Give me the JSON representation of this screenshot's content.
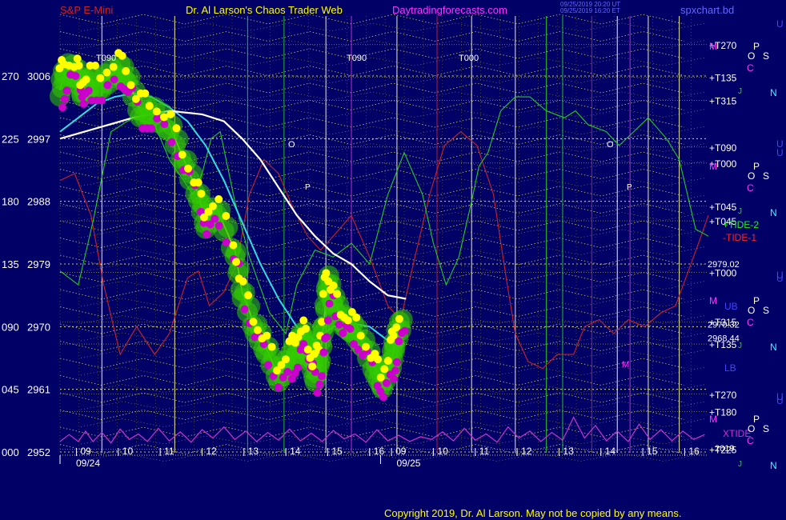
{
  "header": {
    "symbol": "S&P E-Mini",
    "site": "Dr. Al Larson's Chaos Trader Web",
    "url": "Daytradingforecasts.com",
    "timestamp_line1": "09/25/2019 20:20 UT",
    "timestamp_line2": "09/25/2019 16:20 ET",
    "filename": "spxchart.bd"
  },
  "footer": {
    "copyright": "Copyright 2019, Dr. Al Larson. May not be copied by any means."
  },
  "colors": {
    "background": "#000066",
    "price_marker_magenta": "#cc00cc",
    "price_marker_yellow": "#ffff00",
    "price_marker_green": "#33cc00",
    "white_ma": "#ffffff",
    "cyan_ma": "#33dddd",
    "green_tide": "#22cc22",
    "red_tide": "#cc2222",
    "xtide": "#cc33cc"
  },
  "chart_data": {
    "type": "line",
    "title": "S&P E-Mini",
    "y_axis": {
      "ticks": [
        {
          "angle": "270",
          "price": "3006"
        },
        {
          "angle": "225",
          "price": "2997"
        },
        {
          "angle": "180",
          "price": "2988"
        },
        {
          "angle": "135",
          "price": "2979"
        },
        {
          "angle": "090",
          "price": "2970"
        },
        {
          "angle": "045",
          "price": "2961"
        },
        {
          "angle": "000",
          "price": "2952"
        }
      ],
      "ylim": [
        2952,
        3006
      ]
    },
    "x_axis": {
      "hour_ticks": [
        "09",
        "10",
        "11",
        "12",
        "13",
        "14",
        "15",
        "16",
        "09",
        "10",
        "11",
        "12",
        "13",
        "14",
        "15",
        "16"
      ],
      "dates": [
        "09/24",
        "09/25"
      ]
    },
    "series": [
      {
        "key": "price",
        "points": [
          [
            0,
            3004
          ],
          [
            0.3,
            3007
          ],
          [
            1.0,
            3006.5
          ],
          [
            1.2,
            3004
          ],
          [
            1.6,
            3005
          ],
          [
            2.3,
            3005
          ],
          [
            3.2,
            3007
          ],
          [
            3.7,
            3006
          ],
          [
            4.4,
            3001
          ],
          [
            5.0,
            3001
          ],
          [
            6.0,
            2999
          ],
          [
            6.8,
            2994
          ],
          [
            7.6,
            2989
          ],
          [
            8.0,
            2985
          ],
          [
            8.6,
            2987
          ],
          [
            9.6,
            2981
          ],
          [
            10.0,
            2975
          ],
          [
            10.7,
            2970
          ],
          [
            11.3,
            2967
          ],
          [
            12.0,
            2963
          ],
          [
            12.6,
            2965
          ],
          [
            13.0,
            2967
          ],
          [
            13.4,
            2969
          ],
          [
            13.7,
            2966
          ],
          [
            14.0,
            2963
          ],
          [
            14.3,
            2966
          ],
          [
            14.5,
            2971
          ],
          [
            14.7,
            2977
          ],
          [
            15.0,
            2974
          ],
          [
            15.5,
            2971
          ],
          [
            16.0,
            2970
          ],
          [
            16.6,
            2968
          ],
          [
            17.3,
            2964
          ],
          [
            17.7,
            2962
          ],
          [
            18.2,
            2965
          ],
          [
            18.4,
            2968
          ],
          [
            18.8,
            2971
          ]
        ]
      },
      {
        "key": "cyan_ma",
        "points": [
          [
            0,
            2998
          ],
          [
            1.0,
            3000
          ],
          [
            2.0,
            3002
          ],
          [
            3.0,
            3003
          ],
          [
            4.0,
            3003.5
          ],
          [
            5.0,
            3003
          ],
          [
            6.0,
            3001.5
          ],
          [
            7.0,
            2999.5
          ],
          [
            8.0,
            2996
          ],
          [
            9.0,
            2991
          ],
          [
            10.0,
            2985
          ],
          [
            11.0,
            2979
          ],
          [
            12.0,
            2974
          ],
          [
            13.0,
            2970
          ],
          [
            14.0,
            2968
          ],
          [
            15.0,
            2970
          ],
          [
            16.0,
            2970.5
          ],
          [
            17.0,
            2970
          ],
          [
            18.0,
            2968
          ],
          [
            19.0,
            2969
          ]
        ]
      },
      {
        "key": "white_ma",
        "points": [
          [
            0,
            2997
          ],
          [
            2.0,
            2998.5
          ],
          [
            4.0,
            3000
          ],
          [
            6.0,
            3001
          ],
          [
            7.8,
            3000.5
          ],
          [
            9.0,
            2999.5
          ],
          [
            10.0,
            2997
          ],
          [
            11.0,
            2994
          ],
          [
            12.0,
            2990
          ],
          [
            13.0,
            2986
          ],
          [
            14.0,
            2983
          ],
          [
            15.0,
            2980.5
          ],
          [
            16.0,
            2979
          ],
          [
            17.0,
            2976.5
          ],
          [
            18.0,
            2974.5
          ],
          [
            19.0,
            2974
          ]
        ]
      },
      {
        "key": "green_tide",
        "name": "+TIDE-2",
        "points": [
          [
            0,
            2978
          ],
          [
            1.0,
            2976
          ],
          [
            1.8,
            2985
          ],
          [
            2.8,
            2998
          ],
          [
            4.0,
            3000
          ],
          [
            5.2,
            2999
          ],
          [
            6.0,
            2994
          ],
          [
            7.3,
            2989
          ],
          [
            7.8,
            2992
          ],
          [
            8.3,
            2997
          ],
          [
            8.8,
            2998
          ],
          [
            9.6,
            2988
          ],
          [
            10.4,
            2980
          ],
          [
            11.5,
            2972
          ],
          [
            12.4,
            2969
          ],
          [
            13.0,
            2976
          ],
          [
            14.0,
            2981
          ],
          [
            15.0,
            2980
          ],
          [
            16.0,
            2982
          ],
          [
            17.0,
            2979
          ],
          [
            18.0,
            2989
          ],
          [
            18.9,
            2995
          ],
          [
            19.9,
            2989
          ],
          [
            20.5,
            2982
          ],
          [
            21.2,
            2976
          ],
          [
            21.9,
            2980
          ],
          [
            22.6,
            2988
          ],
          [
            23.0,
            2993
          ],
          [
            23.5,
            2995
          ],
          [
            24.2,
            3001
          ],
          [
            25.0,
            3003
          ],
          [
            25.8,
            3003
          ],
          [
            26.7,
            3001
          ],
          [
            27.7,
            3000
          ],
          [
            28.3,
            3001
          ],
          [
            29.0,
            2999
          ],
          [
            30.0,
            2998
          ],
          [
            30.7,
            2996
          ],
          [
            31.5,
            2998
          ],
          [
            32.3,
            3000
          ],
          [
            33.3,
            2997
          ],
          [
            34.0,
            2994
          ],
          [
            34.9,
            2984
          ],
          [
            35.6,
            2983
          ]
        ]
      },
      {
        "key": "red_tide",
        "name": "-TIDE-1",
        "points": [
          [
            0,
            2991
          ],
          [
            0.8,
            2992
          ],
          [
            1.7,
            2986
          ],
          [
            2.4,
            2976
          ],
          [
            3.3,
            2966
          ],
          [
            4.2,
            2970
          ],
          [
            5.2,
            2966
          ],
          [
            6.0,
            2969
          ],
          [
            7.0,
            2977
          ],
          [
            7.6,
            2978
          ],
          [
            8.2,
            2973
          ],
          [
            9.0,
            2975
          ],
          [
            9.7,
            2979
          ],
          [
            10.4,
            2989
          ],
          [
            11.2,
            2994
          ],
          [
            12.0,
            2992
          ],
          [
            12.8,
            2987
          ],
          [
            13.6,
            2983
          ],
          [
            14.3,
            2981
          ],
          [
            15.0,
            2983
          ],
          [
            16.0,
            2986
          ],
          [
            17.0,
            2980
          ],
          [
            18.0,
            2973
          ],
          [
            18.7,
            2971
          ],
          [
            19.4,
            2979
          ],
          [
            20.3,
            2989
          ],
          [
            21.1,
            2996
          ],
          [
            22.0,
            2998
          ],
          [
            22.9,
            2996
          ],
          [
            23.8,
            2989
          ],
          [
            24.5,
            2977
          ],
          [
            25.0,
            2969
          ],
          [
            25.7,
            2965
          ],
          [
            26.5,
            2964
          ],
          [
            27.3,
            2966
          ],
          [
            28.2,
            2966
          ],
          [
            28.8,
            2970
          ],
          [
            29.6,
            2971
          ],
          [
            30.4,
            2969
          ],
          [
            31.2,
            2971
          ],
          [
            32.1,
            2970
          ],
          [
            33.0,
            2972
          ],
          [
            33.8,
            2973
          ],
          [
            34.5,
            2978
          ],
          [
            35.2,
            2983
          ],
          [
            35.6,
            2986
          ]
        ]
      },
      {
        "key": "xtide",
        "name": "XTIDE",
        "points": [
          [
            0,
            2953.5
          ],
          [
            0.5,
            2954.5
          ],
          [
            1.0,
            2953.5
          ],
          [
            1.4,
            2955
          ],
          [
            1.8,
            2953.5
          ],
          [
            2.3,
            2954.8
          ],
          [
            2.8,
            2953.3
          ],
          [
            3.3,
            2955.3
          ],
          [
            3.8,
            2953.8
          ],
          [
            4.3,
            2954.6
          ],
          [
            4.8,
            2953.5
          ],
          [
            5.4,
            2955.4
          ],
          [
            6.0,
            2953.6
          ],
          [
            6.6,
            2954.9
          ],
          [
            7.2,
            2953.4
          ],
          [
            7.8,
            2955.2
          ],
          [
            8.4,
            2954
          ],
          [
            9.0,
            2955.6
          ],
          [
            9.6,
            2953.8
          ],
          [
            10.2,
            2955
          ],
          [
            10.8,
            2953.5
          ],
          [
            11.4,
            2954.8
          ],
          [
            12.0,
            2953.7
          ],
          [
            12.6,
            2955.3
          ],
          [
            13.2,
            2953.6
          ],
          [
            13.8,
            2954.7
          ],
          [
            14.4,
            2953.5
          ],
          [
            15.0,
            2955.1
          ],
          [
            15.6,
            2953.9
          ],
          [
            16.2,
            2954.6
          ],
          [
            16.8,
            2953.4
          ],
          [
            17.4,
            2955.2
          ],
          [
            18.0,
            2953.6
          ],
          [
            18.6,
            2954.4
          ],
          [
            19.2,
            2953.5
          ],
          [
            19.8,
            2954.2
          ],
          [
            20.4,
            2953.8
          ],
          [
            21.0,
            2954.9
          ],
          [
            21.6,
            2953.6
          ],
          [
            22.2,
            2955.4
          ],
          [
            22.8,
            2953.7
          ],
          [
            23.4,
            2954.6
          ],
          [
            24.0,
            2953.4
          ],
          [
            24.6,
            2955.6
          ],
          [
            25.2,
            2954
          ],
          [
            25.8,
            2955
          ],
          [
            26.4,
            2953.5
          ],
          [
            27.0,
            2954.8
          ],
          [
            27.6,
            2953.7
          ],
          [
            28.2,
            2957
          ],
          [
            28.8,
            2954
          ],
          [
            29.4,
            2955.8
          ],
          [
            30.0,
            2953.6
          ],
          [
            30.6,
            2955
          ],
          [
            31.2,
            2953.5
          ],
          [
            31.8,
            2956
          ],
          [
            32.4,
            2953.8
          ],
          [
            33.0,
            2955.2
          ],
          [
            33.6,
            2953.6
          ],
          [
            34.2,
            2955
          ],
          [
            34.8,
            2953.8
          ],
          [
            35.4,
            2954.5
          ]
        ]
      }
    ],
    "gann_labels": [
      {
        "text": "T270",
        "y": 3010.5
      },
      {
        "text": "T135",
        "y": 3005.8
      },
      {
        "text": "T315",
        "y": 3002.5
      },
      {
        "text": "T090",
        "y": 2995.8
      },
      {
        "text": "T000",
        "y": 2993.5
      },
      {
        "text": "T045",
        "y": 2987.3
      },
      {
        "text": "T045",
        "y": 2985.2
      },
      {
        "text": "T000",
        "y": 2977.8
      },
      {
        "text": "T315",
        "y": 2970.7
      },
      {
        "text": "T135",
        "y": 2967.5
      },
      {
        "text": "T270",
        "y": 2960.3
      },
      {
        "text": "T180",
        "y": 2957.8
      },
      {
        "text": "T225",
        "y": 2952.4
      }
    ],
    "price_labels": [
      {
        "text": "2979.02",
        "y": 2979
      },
      {
        "text": "2970.32",
        "y": 2970.3
      },
      {
        "text": "2968.44",
        "y": 2968.4
      }
    ],
    "legend": [
      {
        "text": "+TIDE-2",
        "color": "#22ee22"
      },
      {
        "text": "-TIDE-1",
        "color": "#ff2222"
      },
      {
        "text": "XTIDE",
        "color": "#cc33cc"
      }
    ],
    "cycle_labels": [
      "T090",
      "T090",
      "T000"
    ],
    "ub": "UB",
    "lb": "LB",
    "m_marker": "M",
    "side_symbols": [
      "O",
      "P",
      "S",
      "C",
      "N",
      "J",
      "U"
    ],
    "last_tick": "2019"
  }
}
